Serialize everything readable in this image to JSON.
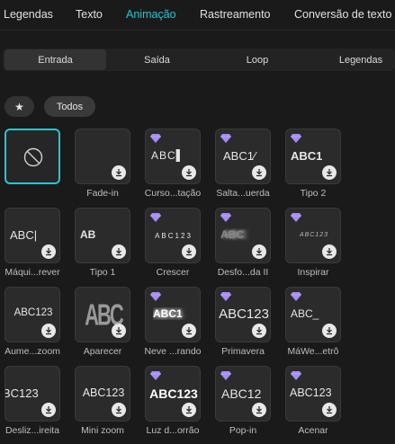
{
  "top_tabs": [
    "Legendas",
    "Texto",
    "Animação",
    "Rastreamento",
    "Conversão de texto"
  ],
  "sub_tabs": [
    "Entrada",
    "Saída",
    "Loop",
    "Legendas"
  ],
  "filters": {
    "favorites_icon": "star-icon",
    "all_label": "Todos"
  },
  "grid": [
    {
      "label": "",
      "preview": "",
      "icon": "none-icon"
    },
    {
      "label": "Fade-in",
      "preview": ""
    },
    {
      "label": "Curso...tação",
      "preview": "ABC▌"
    },
    {
      "label": "Salta...uerda",
      "preview": "ABC1⁄"
    },
    {
      "label": "Tipo 2",
      "preview": "ABC1"
    },
    {
      "label": "Máqui...rever",
      "preview": "ABC|"
    },
    {
      "label": "Tipo 1",
      "preview": "AB"
    },
    {
      "label": "Crescer",
      "preview": "ABC123"
    },
    {
      "label": "Desfo...da II",
      "preview": "ABC"
    },
    {
      "label": "Inspirar",
      "preview": "ABC123"
    },
    {
      "label": "Aume...zoom",
      "preview": "ABC123"
    },
    {
      "label": "Aparecer",
      "preview": "ABC"
    },
    {
      "label": "Neve ...rando",
      "preview": "ABC1"
    },
    {
      "label": "Primavera",
      "preview": "ABC123"
    },
    {
      "label": "MáWe...etrô",
      "preview": "ABC_"
    },
    {
      "label": "Desliz...ireita",
      "preview": "BC123"
    },
    {
      "label": "Mini zoom",
      "preview": "ABC123"
    },
    {
      "label": "Luz d...orrão",
      "preview": "ABC123"
    },
    {
      "label": "Pop-in",
      "preview": "ABC12"
    },
    {
      "label": "Acenar",
      "preview": "ABC123"
    }
  ],
  "colors": {
    "accent": "#22c6d3",
    "premium": "#9b7cf2"
  }
}
